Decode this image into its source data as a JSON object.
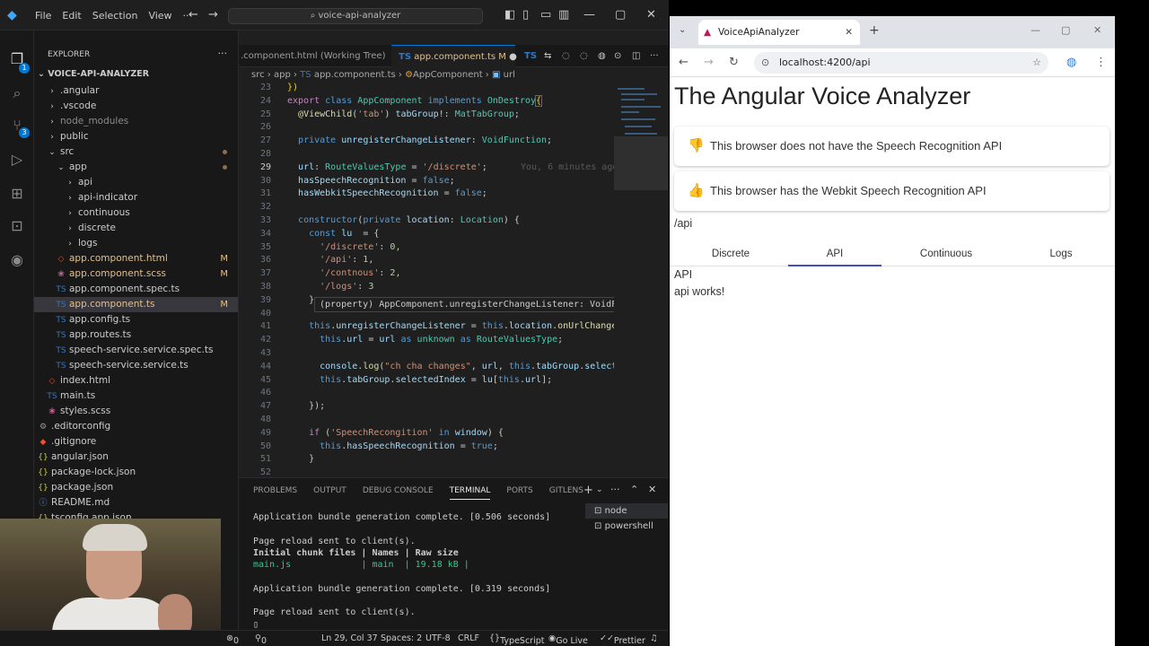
{
  "vscode": {
    "menu": [
      "File",
      "Edit",
      "Selection",
      "View"
    ],
    "command_center": "voice-api-analyzer",
    "explorer": {
      "header": "EXPLORER",
      "root": "VOICE-API-ANALYZER",
      "items": [
        {
          "label": ".angular",
          "icon": "chevron-right"
        },
        {
          "label": ".vscode",
          "icon": "chevron-right"
        },
        {
          "label": "node_modules",
          "icon": "chevron-right"
        },
        {
          "label": "public",
          "icon": "chevron-right"
        },
        {
          "label": "src",
          "icon": "chevron-down"
        },
        {
          "label": "app",
          "icon": "chevron-down"
        },
        {
          "label": "api",
          "icon": "chevron-right"
        },
        {
          "label": "api-indicator",
          "icon": "chevron-right"
        },
        {
          "label": "continuous",
          "icon": "chevron-right"
        },
        {
          "label": "discrete",
          "icon": "chevron-right"
        },
        {
          "label": "logs",
          "icon": "chevron-right"
        },
        {
          "label": "app.component.html",
          "icon": "html",
          "mark": "M"
        },
        {
          "label": "app.component.scss",
          "icon": "scss",
          "mark": "M"
        },
        {
          "label": "app.component.spec.ts",
          "icon": "ts"
        },
        {
          "label": "app.component.ts",
          "icon": "ts",
          "mark": "M"
        },
        {
          "label": "app.config.ts",
          "icon": "ts"
        },
        {
          "label": "app.routes.ts",
          "icon": "ts"
        },
        {
          "label": "speech-service.service.spec.ts",
          "icon": "ts"
        },
        {
          "label": "speech-service.service.ts",
          "icon": "ts"
        },
        {
          "label": "index.html",
          "icon": "html"
        },
        {
          "label": "main.ts",
          "icon": "ts"
        },
        {
          "label": "styles.scss",
          "icon": "scss"
        },
        {
          "label": ".editorconfig",
          "icon": "gear"
        },
        {
          "label": ".gitignore",
          "icon": "git"
        },
        {
          "label": "angular.json",
          "icon": "json"
        },
        {
          "label": "package-lock.json",
          "icon": "json"
        },
        {
          "label": "package.json",
          "icon": "json"
        },
        {
          "label": "README.md",
          "icon": "info"
        },
        {
          "label": "tsconfig.app.json",
          "icon": "json"
        }
      ]
    },
    "tabs": [
      {
        "label": ".component.html (Working Tree)"
      },
      {
        "label": "app.component.ts M"
      }
    ],
    "breadcrumb": [
      "src",
      "app",
      "app.component.ts",
      "AppComponent",
      "url"
    ],
    "line_numbers": [
      "23",
      "24",
      "25",
      "26",
      "27",
      "28",
      "29",
      "30",
      "31",
      "32",
      "33",
      "34",
      "35",
      "36",
      "37",
      "38",
      "39",
      "40",
      "41",
      "42",
      "43",
      "44",
      "45",
      "46",
      "47",
      "48",
      "49",
      "50",
      "51",
      "52"
    ],
    "inline_blame": "You, 6 minutes ago",
    "hover": "(property) AppComponent.unregisterChangeListener: VoidFunction",
    "panel_tabs": [
      "PROBLEMS",
      "OUTPUT",
      "DEBUG CONSOLE",
      "TERMINAL",
      "PORTS",
      "GITLENS"
    ],
    "terminal_lines": [
      "Application bundle generation complete. [0.506 seconds]",
      "",
      "Page reload sent to client(s).",
      "Initial chunk files | Names | Raw size",
      "main.js             | main  | 19.18 kB |",
      "",
      "Application bundle generation complete. [0.319 seconds]",
      "",
      "Page reload sent to client(s).",
      "▯"
    ],
    "terminals": [
      "node",
      "powershell"
    ],
    "status": {
      "errors": "0",
      "warnings": "0",
      "position": "Ln 29, Col 37",
      "spaces": "Spaces: 2",
      "encoding": "UTF-8",
      "eol": "CRLF",
      "language": "TypeScript",
      "golive": "Go Live",
      "prettier": "Prettier"
    }
  },
  "browser": {
    "tab_title": "VoiceApiAnalyzer",
    "url": "localhost:4200/api",
    "page": {
      "title": "The Angular Voice Analyzer",
      "cards": [
        {
          "text": "This browser does not have the Speech Recognition API",
          "icon": "thumbs-down",
          "color": "#a31515"
        },
        {
          "text": "This browser has the Webkit Speech Recognition API",
          "icon": "thumbs-up",
          "color": "#2e7d32"
        }
      ],
      "route": "/api",
      "tabs": [
        "Discrete",
        "API",
        "Continuous",
        "Logs"
      ],
      "active_tab": "API",
      "content_title": "API",
      "content_text": "api works!"
    }
  }
}
